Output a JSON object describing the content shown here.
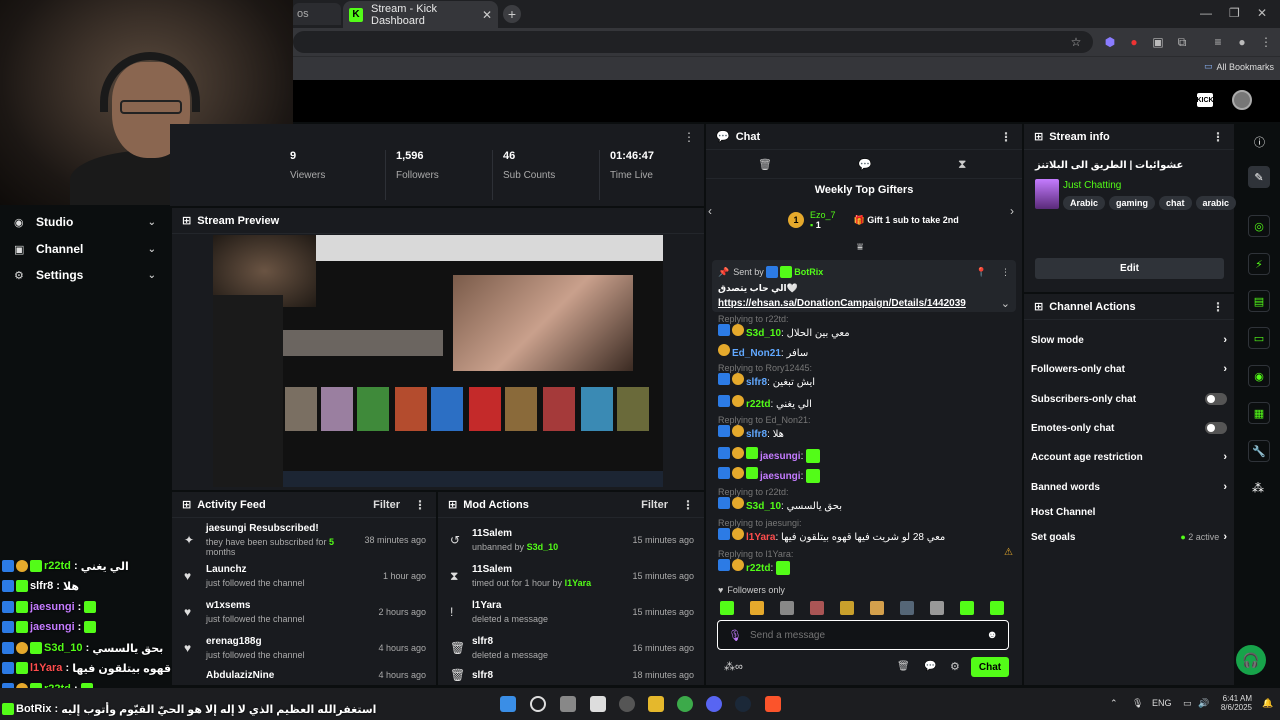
{
  "browser": {
    "inactive_tab_label": "os",
    "active_tab_title": "Stream - Kick Dashboard",
    "tab_close": "✕",
    "new_tab": "+",
    "bookmarks_label": "All Bookmarks"
  },
  "kick_header": {
    "logo": "KICK"
  },
  "sidebar": {
    "items": [
      {
        "label": "Studio"
      },
      {
        "label": "Channel"
      },
      {
        "label": "Settings"
      }
    ]
  },
  "overlay_chat": [
    {
      "user": "r22td",
      "text": "الي يغني"
    },
    {
      "user": "slfr8",
      "text": "هلا"
    },
    {
      "user": "jaesungi",
      "text": ""
    },
    {
      "user": "jaesungi",
      "text": ""
    },
    {
      "user": "S3d_10",
      "text": "بحق يالسسي"
    },
    {
      "user": "l1Yara",
      "text": "معي 28 لو شريت فيها قهوه بيتلقون فيها"
    },
    {
      "user": "r22td",
      "text": ""
    },
    {
      "user": "BotRix",
      "text": "استغفرالله العظيم الذي لا إله إلا هو الحيّ القيّوم وأتوب إليه"
    }
  ],
  "stats": {
    "viewers": {
      "value": "9",
      "label": "Viewers"
    },
    "followers": {
      "value": "1,596",
      "label": "Followers"
    },
    "subs": {
      "value": "46",
      "label": "Sub Counts"
    },
    "time_live": {
      "value": "01:46:47",
      "label": "Time Live"
    }
  },
  "preview": {
    "title": "Stream Preview"
  },
  "activity": {
    "title": "Activity Feed",
    "filter": "Filter",
    "items": [
      {
        "title": "jaesungi Resubscribed!",
        "sub_pre": "they have been subscribed for ",
        "sub_hl": "5",
        "sub_post": " months",
        "time": "38 minutes ago"
      },
      {
        "title": "Launchz",
        "sub": "just followed the channel",
        "time": "1 hour ago"
      },
      {
        "title": "w1xsems",
        "sub": "just followed the channel",
        "time": "2 hours ago"
      },
      {
        "title": "erenag188g",
        "sub": "just followed the channel",
        "time": "4 hours ago"
      },
      {
        "title": "AbdulazizNine",
        "sub": "",
        "time": "4 hours ago"
      }
    ]
  },
  "mod_actions": {
    "title": "Mod Actions",
    "filter": "Filter",
    "items": [
      {
        "title": "11Salem",
        "sub_pre": "unbanned by ",
        "sub_hl": "S3d_10",
        "time": "15 minutes ago"
      },
      {
        "title": "11Salem",
        "sub_pre": "timed out for 1 hour by ",
        "sub_hl": "l1Yara",
        "time": "15 minutes ago"
      },
      {
        "title": "l1Yara",
        "sub": "deleted a message",
        "time": "15 minutes ago"
      },
      {
        "title": "slfr8",
        "sub": "deleted a message",
        "time": "16 minutes ago"
      },
      {
        "title": "slfr8",
        "sub": "",
        "time": "18 minutes ago"
      }
    ]
  },
  "chat": {
    "title": "Chat",
    "gifters_title": "Weekly Top Gifters",
    "top_gifter": {
      "rank": "1",
      "name": "Ezo_7",
      "count": "1"
    },
    "gift_cta": "Gift 1 sub to take 2nd",
    "pinned": {
      "sent_by_label": "Sent by",
      "sender": "BotRix",
      "text": "الي حاب يتصدق🤍",
      "link": "https://ehsan.sa/DonationCampaign/Details/1442039"
    },
    "messages": [
      {
        "reply": "Replying to r22td:",
        "user": "S3d_10",
        "color": "u-green",
        "text": "معي بين الحلال"
      },
      {
        "reply": "",
        "user": "Ed_Non21",
        "color": "u-blue",
        "text": "سافر"
      },
      {
        "reply": "Replying to Rory12445:",
        "user": "slfr8",
        "color": "u-blue",
        "text": "ايش تبغين"
      },
      {
        "reply": "",
        "user": "r22td",
        "color": "u-green",
        "text": "الي يغني"
      },
      {
        "reply": "Replying to Ed_Non21:",
        "user": "slfr8",
        "color": "u-blue",
        "text": "هلا"
      },
      {
        "reply": "",
        "user": "jaesungi",
        "color": "u-purple",
        "text": ""
      },
      {
        "reply": "",
        "user": "jaesungi",
        "color": "u-purple",
        "text": ""
      },
      {
        "reply": "Replying to r22td:",
        "user": "S3d_10",
        "color": "u-green",
        "text": "بحق يالسسي"
      },
      {
        "reply": "Replying to jaesungi:",
        "user": "l1Yara",
        "color": "u-red",
        "text": "معي 28 لو شريت فيها قهوه بيتلقون فيها"
      },
      {
        "reply": "Replying to l1Yara:",
        "user": "r22td",
        "color": "u-green",
        "text": ""
      }
    ],
    "followers_only": "Followers only",
    "input_placeholder": "Send a message",
    "send_label": "Chat"
  },
  "stream_info": {
    "title": "Stream info",
    "stream_title": "عشوائيات | الطريق الى البلاتنز",
    "category": "Just Chatting",
    "tags": [
      "Arabic",
      "gaming",
      "chat",
      "arabic"
    ],
    "edit_label": "Edit"
  },
  "channel_actions": {
    "title": "Channel Actions",
    "rows": [
      {
        "label": "Slow mode",
        "kind": "chevron"
      },
      {
        "label": "Followers-only chat",
        "kind": "chevron"
      },
      {
        "label": "Subscribers-only chat",
        "kind": "toggle"
      },
      {
        "label": "Emotes-only chat",
        "kind": "toggle"
      },
      {
        "label": "Account age restriction",
        "kind": "chevron"
      },
      {
        "label": "Banned words",
        "kind": "chevron"
      },
      {
        "label": "Host Channel",
        "kind": "none"
      },
      {
        "label": "Set goals",
        "kind": "chevron"
      }
    ],
    "goals_status": "2 active"
  },
  "taskbar": {
    "lang": "ENG",
    "time": "6:41 AM",
    "date": "8/6/2025"
  },
  "colors": {
    "accent": "#53fc18",
    "panel": "#191b1f",
    "background": "#0b0e0f"
  }
}
